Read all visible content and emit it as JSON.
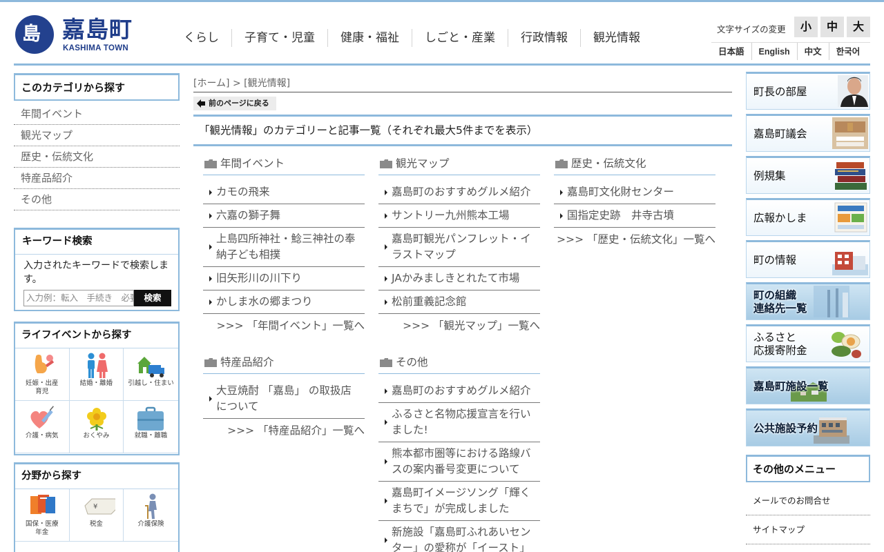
{
  "header": {
    "logo_glyph": "島",
    "logo_title": "嘉島町",
    "logo_sub": "KASHIMA TOWN",
    "nav": [
      "くらし",
      "子育て・児童",
      "健康・福祉",
      "しごと・産業",
      "行政情報",
      "観光情報"
    ],
    "font_size_label": "文字サイズの変更",
    "font_sizes": [
      "小",
      "中",
      "大"
    ],
    "languages": [
      "日本語",
      "English",
      "中文",
      "한국어"
    ]
  },
  "left": {
    "category_title": "このカテゴリから探す",
    "categories": [
      "年間イベント",
      "観光マップ",
      "歴史・伝統文化",
      "特産品紹介",
      "その他"
    ],
    "keyword": {
      "title": "キーワード検索",
      "description": "入力されたキーワードで検索します。",
      "placeholder": "入力例：転入　手続き　必要書類",
      "button": "検索"
    },
    "life_events": {
      "title": "ライフイベントから探す",
      "tiles": [
        {
          "label": "妊娠・出産\n育児",
          "icon": "pregnancy-icon"
        },
        {
          "label": "結婚・離婚",
          "icon": "couple-icon"
        },
        {
          "label": "引越し・住まい",
          "icon": "moving-truck-icon"
        },
        {
          "label": "介護・病気",
          "icon": "heart-syringe-icon"
        },
        {
          "label": "おくやみ",
          "icon": "flower-icon"
        },
        {
          "label": "就職・離職",
          "icon": "briefcase-icon"
        }
      ]
    },
    "fields": {
      "title": "分野から探す",
      "tiles": [
        {
          "label": "国保・医療\n年金",
          "icon": "insurance-card-icon"
        },
        {
          "label": "税金",
          "icon": "money-bag-icon"
        },
        {
          "label": "介護保険",
          "icon": "cane-person-icon"
        }
      ]
    }
  },
  "main": {
    "breadcrumb": "[ホーム] > [観光情報]",
    "back_button": "前のページに戻る",
    "title": "「観光情報」のカテゴリーと記事一覧（それぞれ最大5件までを表示）",
    "blocks": [
      {
        "heading": "年間イベント",
        "articles": [
          "カモの飛来",
          "六嘉の獅子舞",
          "上島四所神社・鯰三神社の奉納子ども相撲",
          "旧矢形川の川下り",
          "かしま水の郷まつり"
        ],
        "more": ">>> 「年間イベント」一覧へ"
      },
      {
        "heading": "観光マップ",
        "articles": [
          "嘉島町のおすすめグルメ紹介",
          "サントリー九州熊本工場",
          "嘉島町観光パンフレット・イラストマップ",
          "JAかみましきとれたて市場",
          "松前重義記念館"
        ],
        "more": ">>> 「観光マップ」一覧へ"
      },
      {
        "heading": "歴史・伝統文化",
        "articles": [
          "嘉島町文化財センター",
          "国指定史跡　井寺古墳"
        ],
        "more": ">>> 「歴史・伝統文化」一覧へ"
      },
      {
        "heading": "特産品紹介",
        "articles": [
          "大豆焼酎 「嘉島」 の取扱店について"
        ],
        "more": ">>> 「特産品紹介」一覧へ"
      },
      {
        "heading": "その他",
        "articles": [
          "嘉島町のおすすめグルメ紹介",
          "ふるさと名物応援宣言を行いました!",
          "熊本都市圏等における路線バスの案内番号変更について",
          "嘉島町イメージソング「輝くまちで」が完成しました",
          "新施設「嘉島町ふれあいセンター」の愛称が「イースト」"
        ],
        "more": ""
      }
    ]
  },
  "right": {
    "banners": [
      {
        "label": "町長の部屋",
        "icon": "mayor-portrait-icon"
      },
      {
        "label": "嘉島町議会",
        "icon": "assembly-hall-icon"
      },
      {
        "label": "例規集",
        "icon": "books-icon"
      },
      {
        "label": "広報かしま",
        "icon": "newsletter-icon"
      },
      {
        "label": "町の情報",
        "icon": "town-building-icon"
      },
      {
        "label": "町の組織\n連絡先一覧",
        "icon": "office-photo-icon"
      },
      {
        "label": "ふるさと\n応援寄附金",
        "icon": "food-gift-icon"
      },
      {
        "label": "嘉島町施設一覧",
        "icon": "landscape-photo-icon"
      },
      {
        "label": "公共施設予約",
        "icon": "facility-photo-icon"
      }
    ],
    "other_title": "その他のメニュー",
    "other_links": [
      "メールでのお問合せ",
      "サイトマップ"
    ]
  },
  "colors": {
    "accent_blue": "#8db9dc",
    "logo_navy": "#1f3d8a"
  }
}
